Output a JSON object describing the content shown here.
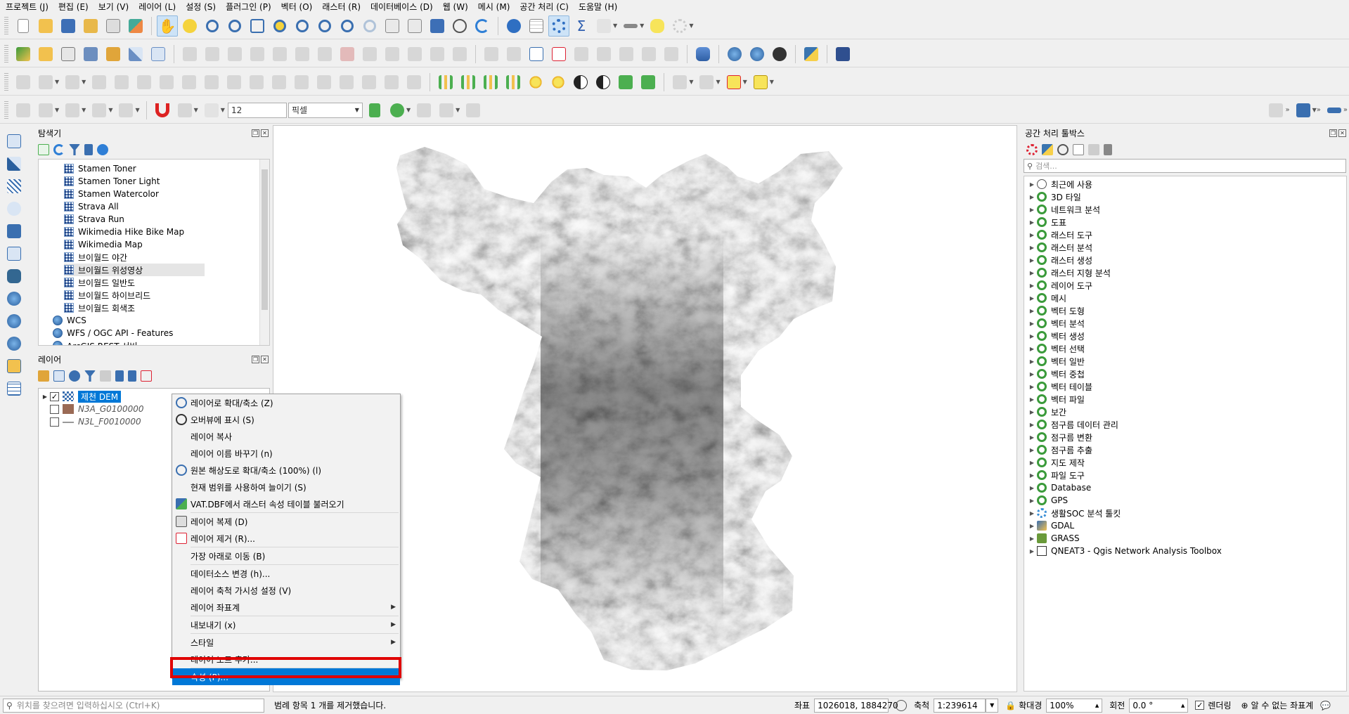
{
  "menu": [
    "프로젝트 (J)",
    "편집 (E)",
    "보기 (V)",
    "레이어 (L)",
    "설정 (S)",
    "플러그인 (P)",
    "벡터 (O)",
    "래스터 (R)",
    "데이터베이스 (D)",
    "웹 (W)",
    "메시 (M)",
    "공간 처리 (C)",
    "도움말 (H)"
  ],
  "toolbar": {
    "font_size_value": "12",
    "unit_value": "픽셀"
  },
  "browser": {
    "title": "탐색기",
    "items": [
      {
        "label": "Stamen Toner",
        "icon": "xyz-tiles-icon"
      },
      {
        "label": "Stamen Toner Light",
        "icon": "xyz-tiles-icon"
      },
      {
        "label": "Stamen Watercolor",
        "icon": "xyz-tiles-icon"
      },
      {
        "label": "Strava All",
        "icon": "xyz-tiles-icon"
      },
      {
        "label": "Strava Run",
        "icon": "xyz-tiles-icon"
      },
      {
        "label": "Wikimedia Hike Bike Map",
        "icon": "xyz-tiles-icon"
      },
      {
        "label": "Wikimedia Map",
        "icon": "xyz-tiles-icon"
      },
      {
        "label": "브이월드 야간",
        "icon": "xyz-tiles-icon"
      },
      {
        "label": "브이월드 위성영상",
        "icon": "xyz-tiles-icon"
      },
      {
        "label": "브이월드 일반도",
        "icon": "xyz-tiles-icon"
      },
      {
        "label": "브이월드 하이브리드",
        "icon": "xyz-tiles-icon"
      },
      {
        "label": "브이월드 회색조",
        "icon": "xyz-tiles-icon"
      },
      {
        "label": "WCS",
        "icon": "globe-icon"
      },
      {
        "label": "WFS / OGC API - Features",
        "icon": "globe-icon"
      },
      {
        "label": "ArcGIS REST 서버",
        "icon": "globe-icon"
      }
    ]
  },
  "layers": {
    "title": "레이어",
    "items": [
      {
        "label": "제천 DEM",
        "checked": true,
        "selected": true
      },
      {
        "label": "N3A_G0100000",
        "checked": false,
        "selected": false
      },
      {
        "label": "N3L_F0010000",
        "checked": false,
        "selected": false
      }
    ]
  },
  "context_menu": {
    "items": [
      "레이어로 확대/축소 (Z)",
      "오버뷰에 표시 (S)",
      "레이어 복사",
      "레이어 이름 바꾸기 (n)",
      "원본 해상도로 확대/축소 (100%) (l)",
      "현재 범위를 사용하여 늘이기 (S)",
      "VAT.DBF에서 래스터 속성 테이블 불러오기",
      "레이어 복제 (D)",
      "레이어 제거 (R)...",
      "가장 아래로 이동 (B)",
      "데이터소스 변경 (h)...",
      "레이어 축척 가시성 설정 (V)",
      "레이어 좌표계",
      "내보내기 (x)",
      "스타일",
      "레이어 노트 추가...",
      "속성 (P)..."
    ]
  },
  "processing": {
    "title": "공간 처리 툴박스",
    "search_placeholder": "검색...",
    "items": [
      "최근에 사용",
      "3D 타일",
      "네트워크 분석",
      "도표",
      "래스터 도구",
      "래스터 분석",
      "래스터 생성",
      "래스터 지형 분석",
      "레이어 도구",
      "메시",
      "벡터 도형",
      "벡터 분석",
      "벡터 생성",
      "벡터 선택",
      "벡터 일반",
      "벡터 중첩",
      "벡터 테이블",
      "벡터 파일",
      "보간",
      "점구름 데이터 관리",
      "점구름 변환",
      "점구름 추출",
      "지도 제작",
      "파일 도구",
      "Database",
      "GPS",
      "생활SOC 분석 툴킷",
      "GDAL",
      "GRASS",
      "QNEAT3 - Qgis Network Analysis Toolbox"
    ]
  },
  "status": {
    "locator_placeholder": "위치를 찾으려면 입력하십시오 (Ctrl+K)",
    "message": "범례 항목 1 개를 제거했습니다.",
    "coord_label": "좌표",
    "coord_value": "1026018, 1884270",
    "scale_label": "축척",
    "scale_value": "1:239614",
    "magnifier_label": "확대경",
    "magnifier_value": "100%",
    "rotation_label": "회전",
    "rotation_value": "0.0 °",
    "render_label": "렌더링",
    "crs_label": "알 수 없는 좌표계"
  },
  "colors": {
    "selection": "#0078d7",
    "highlight_border": "#e00000",
    "qgis_green": "#3b9b3b"
  }
}
